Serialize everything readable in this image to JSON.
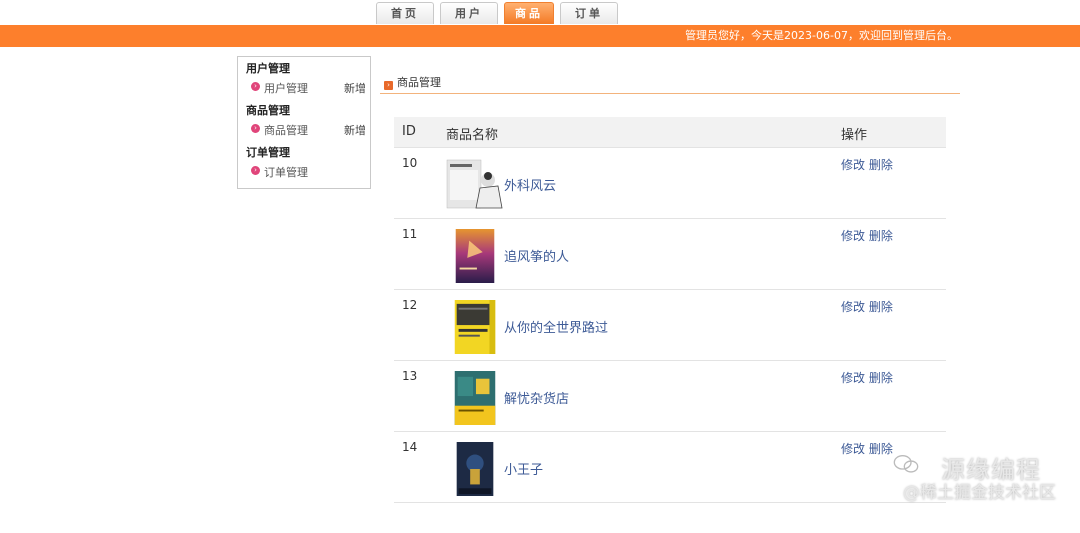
{
  "topnav": {
    "tabs": [
      {
        "label": "首页",
        "active": false
      },
      {
        "label": "用户",
        "active": false
      },
      {
        "label": "商品",
        "active": true
      },
      {
        "label": "订单",
        "active": false
      }
    ]
  },
  "header": {
    "welcome": "管理员您好，今天是2023-06-07，欢迎回到管理后台。",
    "accent_color": "#fd7f2c"
  },
  "sidebar": {
    "sections": [
      {
        "title": "用户管理",
        "item": "用户管理",
        "action": "新增"
      },
      {
        "title": "商品管理",
        "item": "商品管理",
        "action": "新增"
      },
      {
        "title": "订单管理",
        "item": "订单管理",
        "action": ""
      }
    ]
  },
  "main": {
    "title": "商品管理",
    "table": {
      "headers": {
        "id": "ID",
        "name": "商品名称",
        "ops": "操作"
      },
      "rows": [
        {
          "id": "10",
          "name": "外科风云",
          "edit": "修改",
          "delete": "删除"
        },
        {
          "id": "11",
          "name": "追风筝的人",
          "edit": "修改",
          "delete": "删除"
        },
        {
          "id": "12",
          "name": "从你的全世界路过",
          "edit": "修改",
          "delete": "删除"
        },
        {
          "id": "13",
          "name": "解忧杂货店",
          "edit": "修改",
          "delete": "删除"
        },
        {
          "id": "14",
          "name": "小王子",
          "edit": "修改",
          "delete": "删除"
        }
      ]
    }
  },
  "watermark": {
    "title": "源缘编程",
    "subtitle": "@稀土掘金技术社区"
  }
}
